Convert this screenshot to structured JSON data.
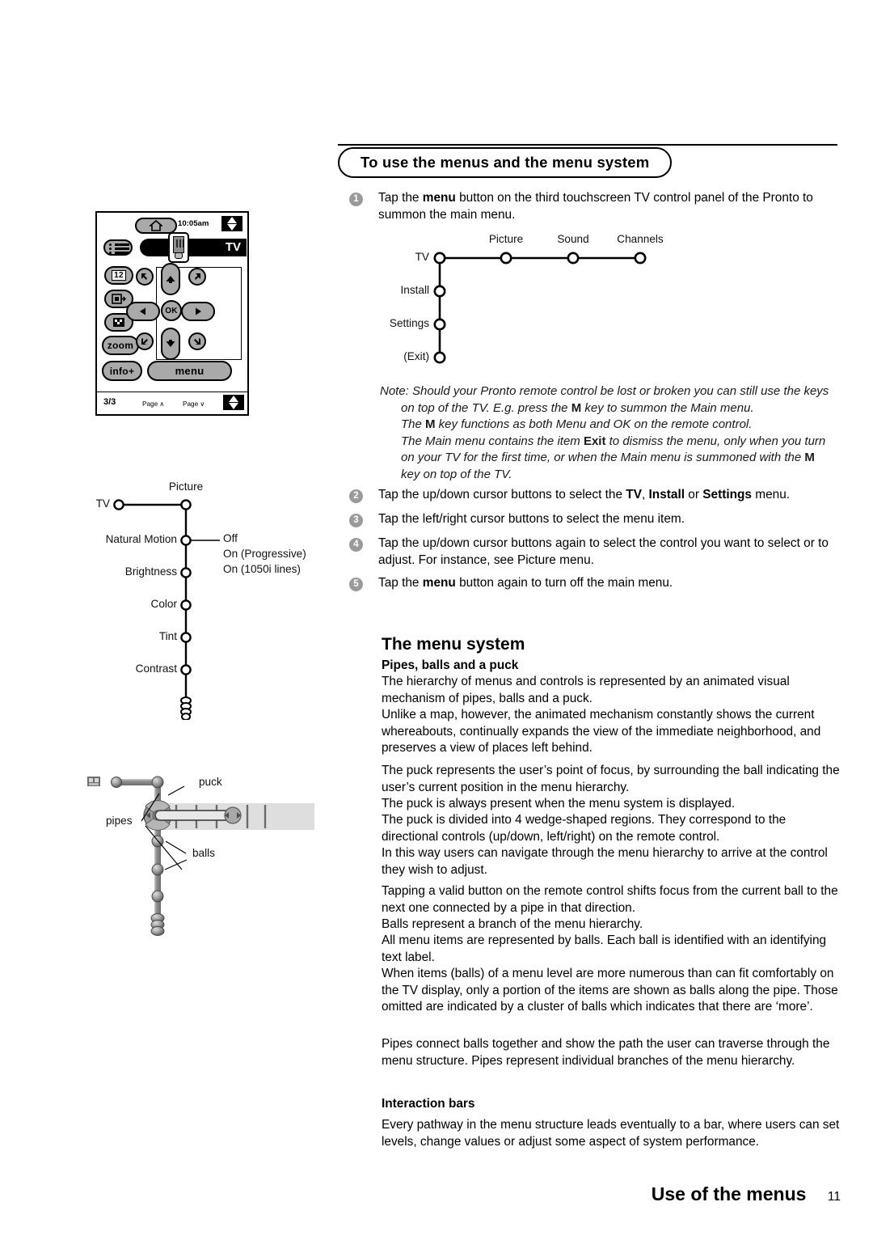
{
  "header": {
    "title": "To use the menus and the menu system"
  },
  "steps": [
    {
      "num": "1",
      "html": "Tap the <b>menu</b> button on the third touchscreen TV control panel of the Pronto to summon the main menu."
    },
    {
      "num": "2",
      "html": "Tap the up/down cursor buttons to select the <b>TV</b>, <b>Install</b> or <b>Settings</b> menu."
    },
    {
      "num": "3",
      "html": "Tap the left/right cursor buttons to select the menu item."
    },
    {
      "num": "4",
      "html": "Tap the up/down cursor buttons again to select the control you want to select or to adjust. For instance, see Picture menu."
    },
    {
      "num": "5",
      "html": "Tap the <b>menu</b> button again to turn off the main menu."
    }
  ],
  "note": {
    "line1": "Note: Should your Pronto remote control be lost or broken you can still use the keys",
    "line2": "on top of the TV.  E.g. press the <b>M</b> key to summon the Main menu.",
    "line3": "The <b>M</b> key functions as both Menu and OK on the remote control.",
    "line4": "The Main menu contains the item <b>Exit</b> to dismiss the menu, only when you turn on your TV for the first time, or when the Main menu is summoned with the <b>M</b> key on top of the TV."
  },
  "sections": {
    "menu_system_heading": "The menu system",
    "pipes_heading": "Pipes, balls and a puck",
    "p1": "The hierarchy of menus and controls is represented by an animated visual mechanism of pipes, balls and a puck.",
    "p2": "Unlike a map, however, the animated mechanism constantly shows the current whereabouts, continually expands the view of the immediate neighborhood, and preserves a view of places left behind.",
    "p3": "The puck represents the user’s point of focus, by surrounding the ball indicating the user’s current position in the menu hierarchy.",
    "p4": "The puck is always present when the menu system is displayed.",
    "p5": "The puck is divided into 4 wedge-shaped regions. They correspond to the directional controls (up/down, left/right) on the remote control.",
    "p6": "In this way users can navigate through the menu hierarchy to arrive at the control they wish to adjust.",
    "p7": "Tapping a valid button on the remote control shifts focus from the current ball to the next one connected by a pipe in that direction.",
    "p8": "Balls represent a branch of the menu hierarchy.",
    "p9": "All menu items are represented by balls. Each ball is identified with an identifying text label.",
    "p10": "When items (balls) of a menu level are more numerous than can fit comfortably on the TV display, only a portion of the items are shown as balls along the pipe. Those omitted are indicated by a cluster of balls which indicates that there are ‘more’.",
    "p11": "Pipes connect balls together and show the path the user can traverse through the menu structure. Pipes represent individual branches of the menu hierarchy.",
    "interaction_heading": "Interaction bars",
    "p12": "Every pathway in the menu structure leads eventually to a bar, where users can set levels, change values or adjust some aspect of system performance."
  },
  "footer": {
    "title": "Use of the menus",
    "page": "11"
  },
  "remote": {
    "time": "10:05am",
    "device_label": "TV",
    "home_icon": "home-icon",
    "list_icon": "list-icon",
    "keys": {
      "numbers": "12",
      "pip": "pip-icon",
      "mosaic": "mosaic-icon",
      "zoom": "zoom",
      "info": "info+",
      "menu": "menu",
      "ok": "OK"
    },
    "cursor": {
      "up": "up-arrow-icon",
      "down": "down-arrow-icon",
      "left": "left-arrow-icon",
      "right": "right-arrow-icon",
      "upleft": "up-left-arrow-icon",
      "upright": "up-right-arrow-icon",
      "downleft": "down-left-arrow-icon",
      "downright": "down-right-arrow-icon"
    },
    "footer": {
      "page_indicator": "3/3",
      "page_up": "Page ∧",
      "page_down": "Page ∨"
    }
  },
  "main_menu_diagram": {
    "root": "TV",
    "horizontal": [
      "Picture",
      "Sound",
      "Channels"
    ],
    "vertical": [
      "Install",
      "Settings",
      "(Exit)"
    ]
  },
  "picture_menu_diagram": {
    "root": "TV",
    "branch": "Picture",
    "items": [
      "Natural Motion",
      "Brightness",
      "Color",
      "Tint",
      "Contrast"
    ],
    "natural_motion_options": [
      "Off",
      "On (Progressive)",
      "On (1050i lines)"
    ]
  },
  "pipes_diagram": {
    "labels": [
      "puck",
      "pipes",
      "balls"
    ]
  }
}
